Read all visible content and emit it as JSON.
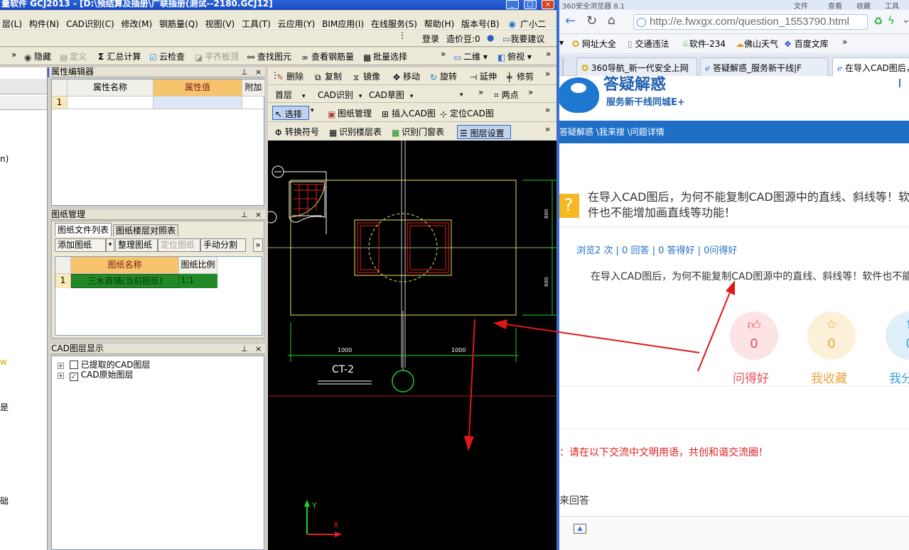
{
  "app": {
    "title": "量软件 GCJ2013 - [D:\\预结算及插册\\广联插册(测试--2180.GCJ12]",
    "menu": [
      "层(L)",
      "构件(N)",
      "CAD识别(C)",
      "修改(M)",
      "钢筋量(Q)",
      "视图(V)",
      "工具(T)",
      "云应用(Y)",
      "BIM应用(I)",
      "在线服务(S)",
      "帮助(H)",
      "版本号(B)",
      "广小二"
    ],
    "infobar": {
      "login": "登录",
      "cost_label": "造价豆:0",
      "suggest": "我要建议"
    },
    "toolbar": {
      "hide": "隐藏",
      "define": "定义",
      "sum_calc": "汇总计算",
      "cloud_check": "云检查",
      "level_slab": "平齐板顶",
      "find_element": "查找图元",
      "view_rebar": "查看钢筋量",
      "batch_select": "批量选择",
      "view_2d": "二维",
      "view_top": "俯视"
    },
    "attr_editor": {
      "title": "属性编辑器",
      "headers": [
        "属性名称",
        "属性值",
        "附加"
      ],
      "rows": [
        {
          "index": "1",
          "name": "",
          "value": ""
        }
      ]
    },
    "drawing_mgmt": {
      "title": "图纸管理",
      "tabs": [
        "图纸文件列表",
        "图纸楼层对照表"
      ],
      "buttons": [
        "添加图纸",
        "整理图纸",
        "定位图纸",
        "手动分割"
      ],
      "headers": [
        "图纸名称",
        "图纸比例"
      ],
      "rows": [
        {
          "index": "1",
          "name": "三水商铺(当前图纸)",
          "scale": "1:1"
        }
      ]
    },
    "layer_panel": {
      "title": "CAD图层显示",
      "items": [
        {
          "label": "已提取的CAD图层",
          "checked": false
        },
        {
          "label": "CAD原始图层",
          "checked": true
        }
      ]
    },
    "left_strip_marks": [
      "n)",
      "w",
      "是",
      "",
      "",
      "础"
    ],
    "cad_tools": {
      "row1": [
        "删除",
        "复制",
        "镜像",
        "移动",
        "旋转",
        "延伸",
        "修剪"
      ],
      "row2": {
        "floor": "首层",
        "cad_recog": "CAD识别",
        "cad_draft": "CAD草图",
        "blank": "",
        "two_points": "两点"
      },
      "row3": [
        "选择",
        "图纸管理",
        "插入CAD图",
        "定位CAD图"
      ],
      "row4": [
        "转换符号",
        "识别楼层表",
        "识别门窗表",
        "图层设置"
      ]
    },
    "drawing": {
      "dim_left": "1000",
      "dim_right": "1000",
      "dim_vertical_top": "600",
      "dim_vertical_bottom": "600",
      "label": "CT-2",
      "axis_y": "Y",
      "axis_x": "X"
    }
  },
  "browser": {
    "title": "360安全浏览器 8.1",
    "title_menu": [
      "文件",
      "查看",
      "收藏",
      "工具"
    ],
    "url": "http://e.fwxgx.com/question_1553790.html",
    "favorites": [
      "网址大全",
      "交通违法",
      "软件-234",
      "佛山天气",
      "百度文库"
    ],
    "tabs": [
      "360导航_新一代安全上网",
      "答疑解惑_服务新干线|F",
      "在导入CAD图后，"
    ],
    "site": {
      "brand_title": "答疑解惑",
      "brand_sub": "服务新干线同城E+",
      "breadcrumb": "答疑解惑 \\我来搜 \\问题详情",
      "question_title": "在导入CAD图后，为何不能复制CAD图源中的直线、斜线等！软件也不能增加画直线等功能！",
      "stats": "浏览2 次 | 0 回答 | 0 答得好 | 0问得好",
      "question_body": "在导入CAD图后，为何不能复制CAD图源中的直线、斜线等！软件也不能增加画直线等功能！",
      "actions": [
        {
          "label": "问得好",
          "count": "0",
          "color": "#e8505b",
          "bg": "#fde3e4"
        },
        {
          "label": "我收藏",
          "count": "0",
          "color": "#e8a640",
          "bg": "#fdf0d8"
        },
        {
          "label": "我分享",
          "count": "0",
          "color": "#3aa0e0",
          "bg": "#dff0fb"
        }
      ],
      "notice": "：请在以下交流中文明用语，共创和谐交流圈！",
      "answer_label": "来回答"
    }
  }
}
